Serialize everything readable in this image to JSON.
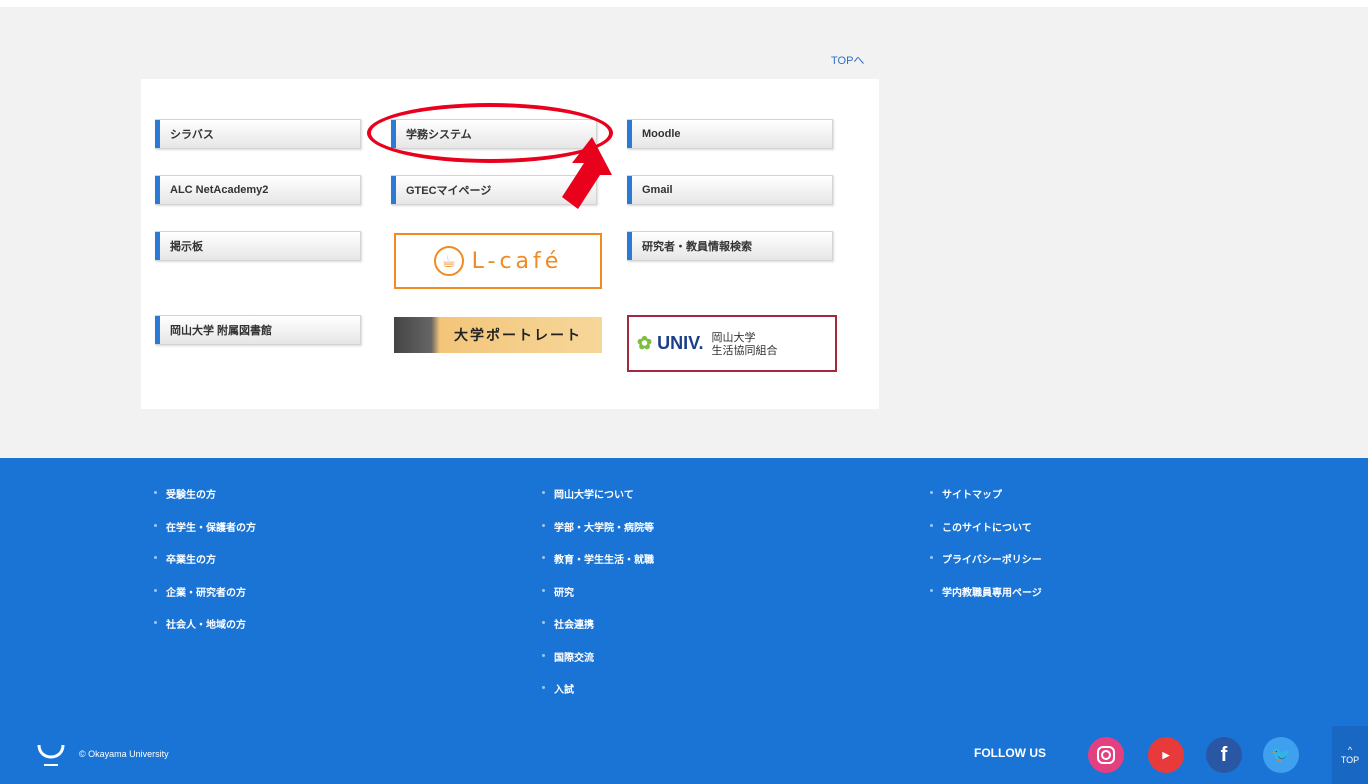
{
  "nav": {
    "top_link": "TOPへ"
  },
  "links": {
    "syllabus": "シラバス",
    "gakumu": "学務システム",
    "moodle": "Moodle",
    "alc": "ALC NetAcademy2",
    "gtec": "GTECマイページ",
    "gmail": "Gmail",
    "board": "掲示板",
    "research": "研究者・教員情報検索",
    "library": "岡山大学 附属図書館"
  },
  "banners": {
    "lcafe": "L-café",
    "portrait": "大学ポートレート",
    "coop_logo": "UNIV.",
    "coop_name_1": "岡山大学",
    "coop_name_2": "生活協同組合"
  },
  "footer": {
    "col1": [
      "受験生の方",
      "在学生・保護者の方",
      "卒業生の方",
      "企業・研究者の方",
      "社会人・地域の方"
    ],
    "col2": [
      "岡山大学について",
      "学部・大学院・病院等",
      "教育・学生生活・就職",
      "研究",
      "社会連携",
      "国際交流",
      "入試"
    ],
    "col3": [
      "サイトマップ",
      "このサイトについて",
      "プライバシーポリシー",
      "学内教職員専用ページ"
    ],
    "copyright": "© Okayama University",
    "follow_us": "FOLLOW US",
    "to_top": "TOP"
  },
  "colors": {
    "accent_blue": "#1a74d6",
    "annotation_red": "#e8001c",
    "lcafe_orange": "#f08a22",
    "coop_border": "#a22a3e"
  }
}
